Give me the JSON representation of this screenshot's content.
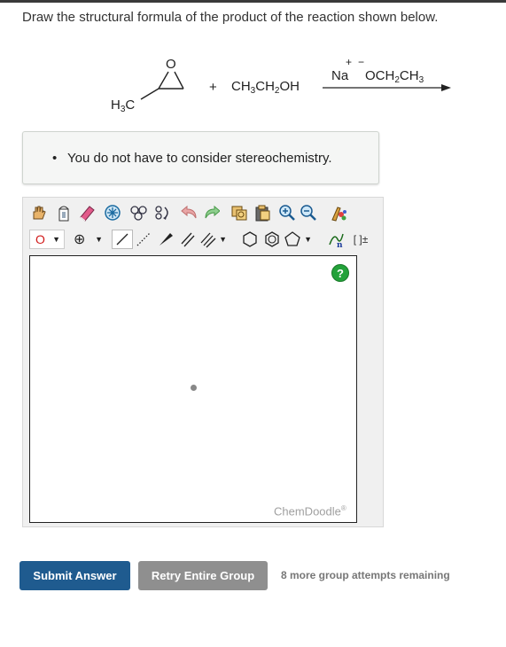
{
  "question": {
    "text": "Draw the structural formula of the product of the reaction shown below."
  },
  "reaction": {
    "reactant_label": "H3C",
    "epoxide_atom": "O",
    "plus": "+",
    "reagent": "CH3CH2OH",
    "cation": "Na",
    "cation_charge": "+",
    "anion": "OCH2CH3",
    "anion_charge": "−"
  },
  "note": {
    "bullet": "•",
    "text": "You do not have to consider stereochemistry."
  },
  "editor": {
    "element_selector": "O",
    "charge_symbol": "⊕",
    "bracket_label": "[ ]±",
    "help_label": "?",
    "brand": "ChemDoodle",
    "brand_mark": "®"
  },
  "buttons": {
    "submit": "Submit Answer",
    "retry": "Retry Entire Group"
  },
  "attempts": "8 more group attempts remaining",
  "colors": {
    "submit": "#1f5b8f",
    "retry": "#8f8f8f",
    "help": "#23a23a",
    "element_red": "#d11a1a"
  }
}
